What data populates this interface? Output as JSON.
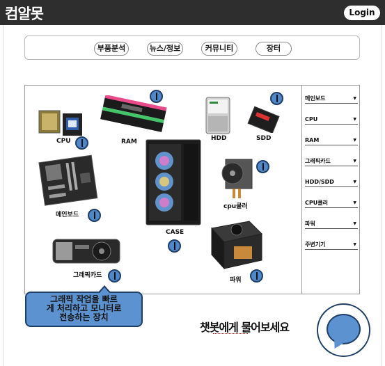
{
  "header": {
    "brand": "컴알못",
    "login_label": "Login"
  },
  "nav": {
    "items": [
      "부품분석",
      "뉴스/정보",
      "커뮤니티",
      "장터"
    ]
  },
  "parts": {
    "cpu": "CPU",
    "ram": "RAM",
    "hdd": "HDD",
    "ssd": "SDD",
    "mainboard": "메인보드",
    "case": "CASE",
    "cooler": "cpu쿨러",
    "gpu": "그래픽카드",
    "power": "파워"
  },
  "categories": [
    "메인보드",
    "CPU",
    "RAM",
    "그래픽카드",
    "HDD/SDD",
    "CPU쿨러",
    "파워",
    "주변기기"
  ],
  "tooltip": {
    "lines": [
      "그래픽 작업을 빠르",
      "게 처리하고 모니터로",
      "전송하는 장치"
    ]
  },
  "chatbot": {
    "prompt": "챗봇에게 물어보세요"
  },
  "colors": {
    "header_bg": "#2e2e2e",
    "accent_blue": "#5b92cf",
    "outline_navy": "#1f3e66"
  }
}
